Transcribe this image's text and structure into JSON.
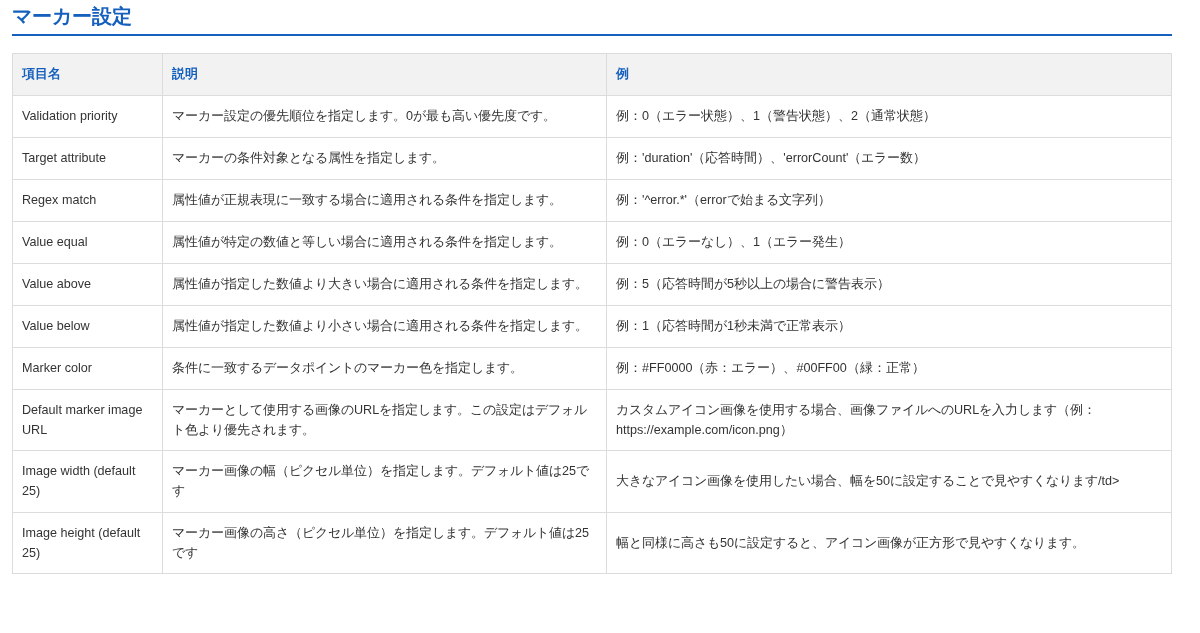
{
  "heading": "マーカー設定",
  "table": {
    "columns": [
      "項目名",
      "説明",
      "例"
    ],
    "rows": [
      [
        "Validation priority",
        "マーカー設定の優先順位を指定します。0が最も高い優先度です。",
        "例：0（エラー状態）、1（警告状態）、2（通常状態）"
      ],
      [
        "Target attribute",
        "マーカーの条件対象となる属性を指定します。",
        "例：'duration'（応答時間）、'errorCount'（エラー数）"
      ],
      [
        "Regex match",
        "属性値が正規表現に一致する場合に適用される条件を指定します。",
        "例：'^error.*'（errorで始まる文字列）"
      ],
      [
        "Value equal",
        "属性値が特定の数値と等しい場合に適用される条件を指定します。",
        "例：0（エラーなし）、1（エラー発生）"
      ],
      [
        "Value above",
        "属性値が指定した数値より大きい場合に適用される条件を指定します。",
        "例：5（応答時間が5秒以上の場合に警告表示）"
      ],
      [
        "Value below",
        "属性値が指定した数値より小さい場合に適用される条件を指定します。",
        "例：1（応答時間が1秒未満で正常表示）"
      ],
      [
        "Marker color",
        "条件に一致するデータポイントのマーカー色を指定します。",
        "例：#FF0000（赤：エラー）、#00FF00（緑：正常）"
      ],
      [
        "Default marker image URL",
        "マーカーとして使用する画像のURLを指定します。この設定はデフォルト色より優先されます。",
        "カスタムアイコン画像を使用する場合、画像ファイルへのURLを入力します（例：https://example.com/icon.png）"
      ],
      [
        "Image width (default 25)",
        "マーカー画像の幅（ピクセル単位）を指定します。デフォルト値は25です",
        "大きなアイコン画像を使用したい場合、幅を50に設定することで見やすくなります/td>"
      ],
      [
        "Image height (default 25)",
        "マーカー画像の高さ（ピクセル単位）を指定します。デフォルト値は25です",
        "幅と同様に高さも50に設定すると、アイコン画像が正方形で見やすくなります。"
      ]
    ]
  }
}
